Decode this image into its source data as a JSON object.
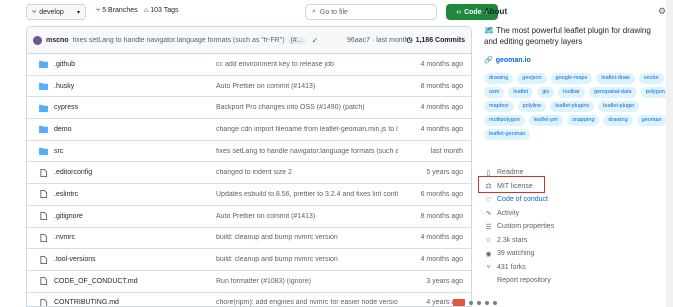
{
  "toolbar": {
    "branch": "develop",
    "branches": "5 Branches",
    "tags": "103 Tags",
    "search_placeholder": "Go to file",
    "code_label": "Code"
  },
  "commit": {
    "author": "mscno",
    "message": "fixes setLang to handle navigator.language formats (such as \"fr-FR\")",
    "badge": "(#...",
    "hash": "96aac7 · last month",
    "commits_count": "1,186 Commits"
  },
  "files": [
    {
      "type": "folder",
      "name": ".github",
      "message": "ci: add environment key to release job",
      "time": "4 months ago"
    },
    {
      "type": "folder",
      "name": ".husky",
      "message": "Auto Prettier on commit (#1413)",
      "time": "8 months ago"
    },
    {
      "type": "folder",
      "name": "cypress",
      "message": "Backport Pro changes into OSS (#1490) (patch)",
      "time": "4 months ago"
    },
    {
      "type": "folder",
      "name": "demo",
      "message": "change cdn import filename from leaflet-geoman.min.js to l...",
      "time": "4 months ago"
    },
    {
      "type": "folder",
      "name": "src",
      "message": "fixes setLang to handle navigator.language formats (such as ...",
      "time": "last month"
    },
    {
      "type": "file",
      "name": ".editorconfig",
      "message": "changed to indent size 2",
      "time": "5 years ago"
    },
    {
      "type": "file",
      "name": ".eslintrc",
      "message": "Updates esbuild to 8.56, prettier to 3.2.4 and fixes lint config...",
      "time": "6 months ago"
    },
    {
      "type": "file",
      "name": ".gitignore",
      "message": "Auto Prettier on commit (#1413)",
      "time": "8 months ago"
    },
    {
      "type": "file",
      "name": ".nvmrc",
      "message": "build: cleanup and bump nvmrc version",
      "time": "4 months ago"
    },
    {
      "type": "file",
      "name": ".tool-versions",
      "message": "build: cleanup and bump nvmrc version",
      "time": "4 months ago"
    },
    {
      "type": "file",
      "name": "CODE_OF_CONDUCT.md",
      "message": "Run formatter (#1083) (ignore)",
      "time": "3 years ago"
    },
    {
      "type": "file",
      "name": "CONTRIBUTING.md",
      "message": "chore(npm): add engines and nvmrc for easier node version ...",
      "time": "4 years ago"
    }
  ],
  "about": {
    "title": "About",
    "description": "🗺️ The most powerful leaflet plugin for drawing and editing geometry layers",
    "website": "geoman.io",
    "topics": [
      "drawing",
      "geojson",
      "google-maps",
      "leaflet-draw",
      "vector",
      "osm",
      "leaflet",
      "gis",
      "toolbar",
      "geospatial-data",
      "polygon",
      "mapbox",
      "polyline",
      "leaflet-plugins",
      "leaflet-plugin",
      "multipolygon",
      "leaflet-pm",
      "snapping",
      "drawing",
      "geoman",
      "leaflet-geoman"
    ],
    "items": [
      {
        "icon": "book-icon",
        "glyph": "▯",
        "label": "Readme",
        "link": false
      },
      {
        "icon": "scale-icon",
        "glyph": "⚖",
        "label": "MIT license",
        "link": false
      },
      {
        "icon": "heart-icon",
        "glyph": "♡",
        "label": "Code of conduct",
        "link": true
      },
      {
        "icon": "pulse-icon",
        "glyph": "∿",
        "label": "Activity",
        "link": false
      },
      {
        "icon": "properties-icon",
        "glyph": "☰",
        "label": "Custom properties",
        "link": false
      },
      {
        "icon": "star-icon",
        "glyph": "☆",
        "label": "2.3k stars",
        "link": false
      },
      {
        "icon": "eye-icon",
        "glyph": "◉",
        "label": "39 watching",
        "link": false
      },
      {
        "icon": "fork-icon",
        "glyph": "⑂",
        "label": "431 forks",
        "link": false
      },
      {
        "icon": "report-icon",
        "glyph": "",
        "label": "Report repository",
        "link": false
      }
    ]
  },
  "colors": {
    "accent": "#1f883d",
    "link": "#0969da",
    "highlight": "#d93025",
    "folder": "#54aeff"
  }
}
